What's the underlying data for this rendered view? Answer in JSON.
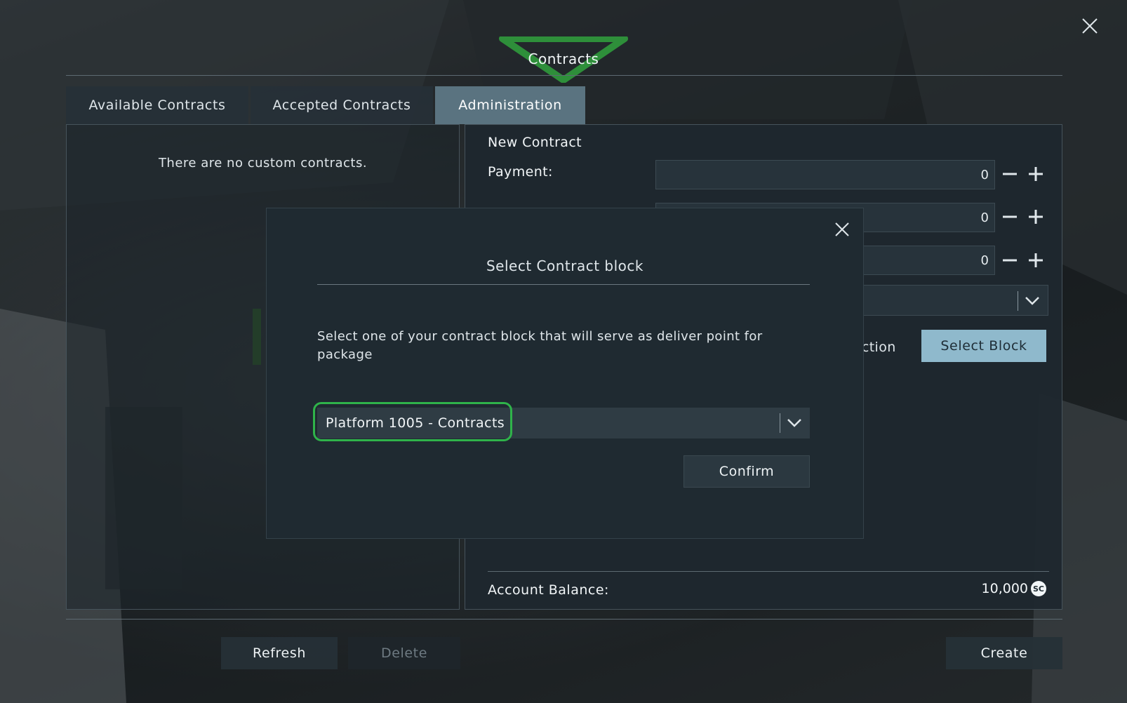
{
  "window": {
    "title": "Contracts"
  },
  "tabs": [
    {
      "label": "Available Contracts",
      "active": false
    },
    {
      "label": "Accepted Contracts",
      "active": false
    },
    {
      "label": "Administration",
      "active": true
    }
  ],
  "left_panel": {
    "empty_message": "There are no custom contracts."
  },
  "new_contract": {
    "heading": "New Contract",
    "payment_label": "Payment:",
    "payment_value": "0",
    "field2_value": "0",
    "field3_value": "0",
    "selection_label_partial": "election",
    "select_block_label": "Select Block",
    "balance_label": "Account Balance:",
    "balance_value": "10,000",
    "currency_symbol": "SC"
  },
  "buttons": {
    "refresh": "Refresh",
    "delete": "Delete",
    "create": "Create"
  },
  "modal": {
    "title": "Select Contract block",
    "description": "Select one of your contract block that will serve as deliver point for package",
    "selected_block": "Platform 1005 - Contracts",
    "confirm_label": "Confirm"
  },
  "colors": {
    "accent_active_tab": "#5a7380",
    "select_block_button": "#8fb9cc",
    "highlight_ring": "#2fb34a",
    "title_triangle": "#2e8f3a"
  }
}
